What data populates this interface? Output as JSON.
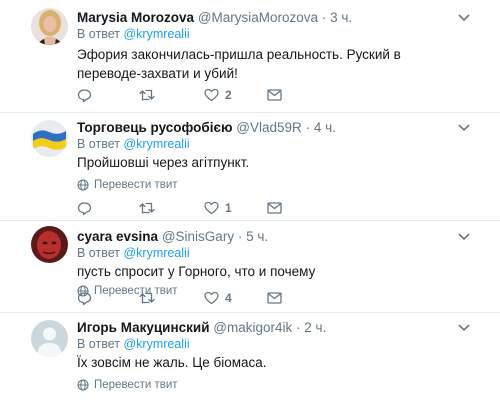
{
  "reply_prefix": "В ответ",
  "tweets": [
    {
      "name": "Marysia Morozova",
      "handle": "@MarysiaMorozova",
      "time": "3 ч.",
      "reply_to": "@krymrealii",
      "text": "Эфория закончилась-пришла реальность. Руский в переводе-захвати и убий!",
      "translate": "",
      "likes": "2",
      "avatar": "woman-photo"
    },
    {
      "name": "Торговець русофобією",
      "handle": "@Vlad59R",
      "time": "4 ч.",
      "reply_to": "@krymrealii",
      "text": "Пройшовші через агітпункт.",
      "translate": "Перевести твит",
      "likes": "1",
      "avatar": "ukraine-flag"
    },
    {
      "name": "cyara evsina",
      "handle": "@SinisGary",
      "time": "5 ч.",
      "reply_to": "@krymrealii",
      "text": "пусть спросит у Горного, что и почему",
      "translate": "Перевести твит",
      "likes": "4",
      "avatar": "red-face-photo"
    },
    {
      "name": "Игорь Макуцинский",
      "handle": "@makigor4ik",
      "time": "2 ч.",
      "reply_to": "@krymrealii",
      "text": "Їх зовсім не жаль. Це біомаса.",
      "translate": "Перевести твит",
      "likes": "",
      "avatar": "default-avatar"
    }
  ],
  "colors": {
    "link": "#1da1f2",
    "muted": "#657786",
    "divider": "#e6ecf0"
  }
}
